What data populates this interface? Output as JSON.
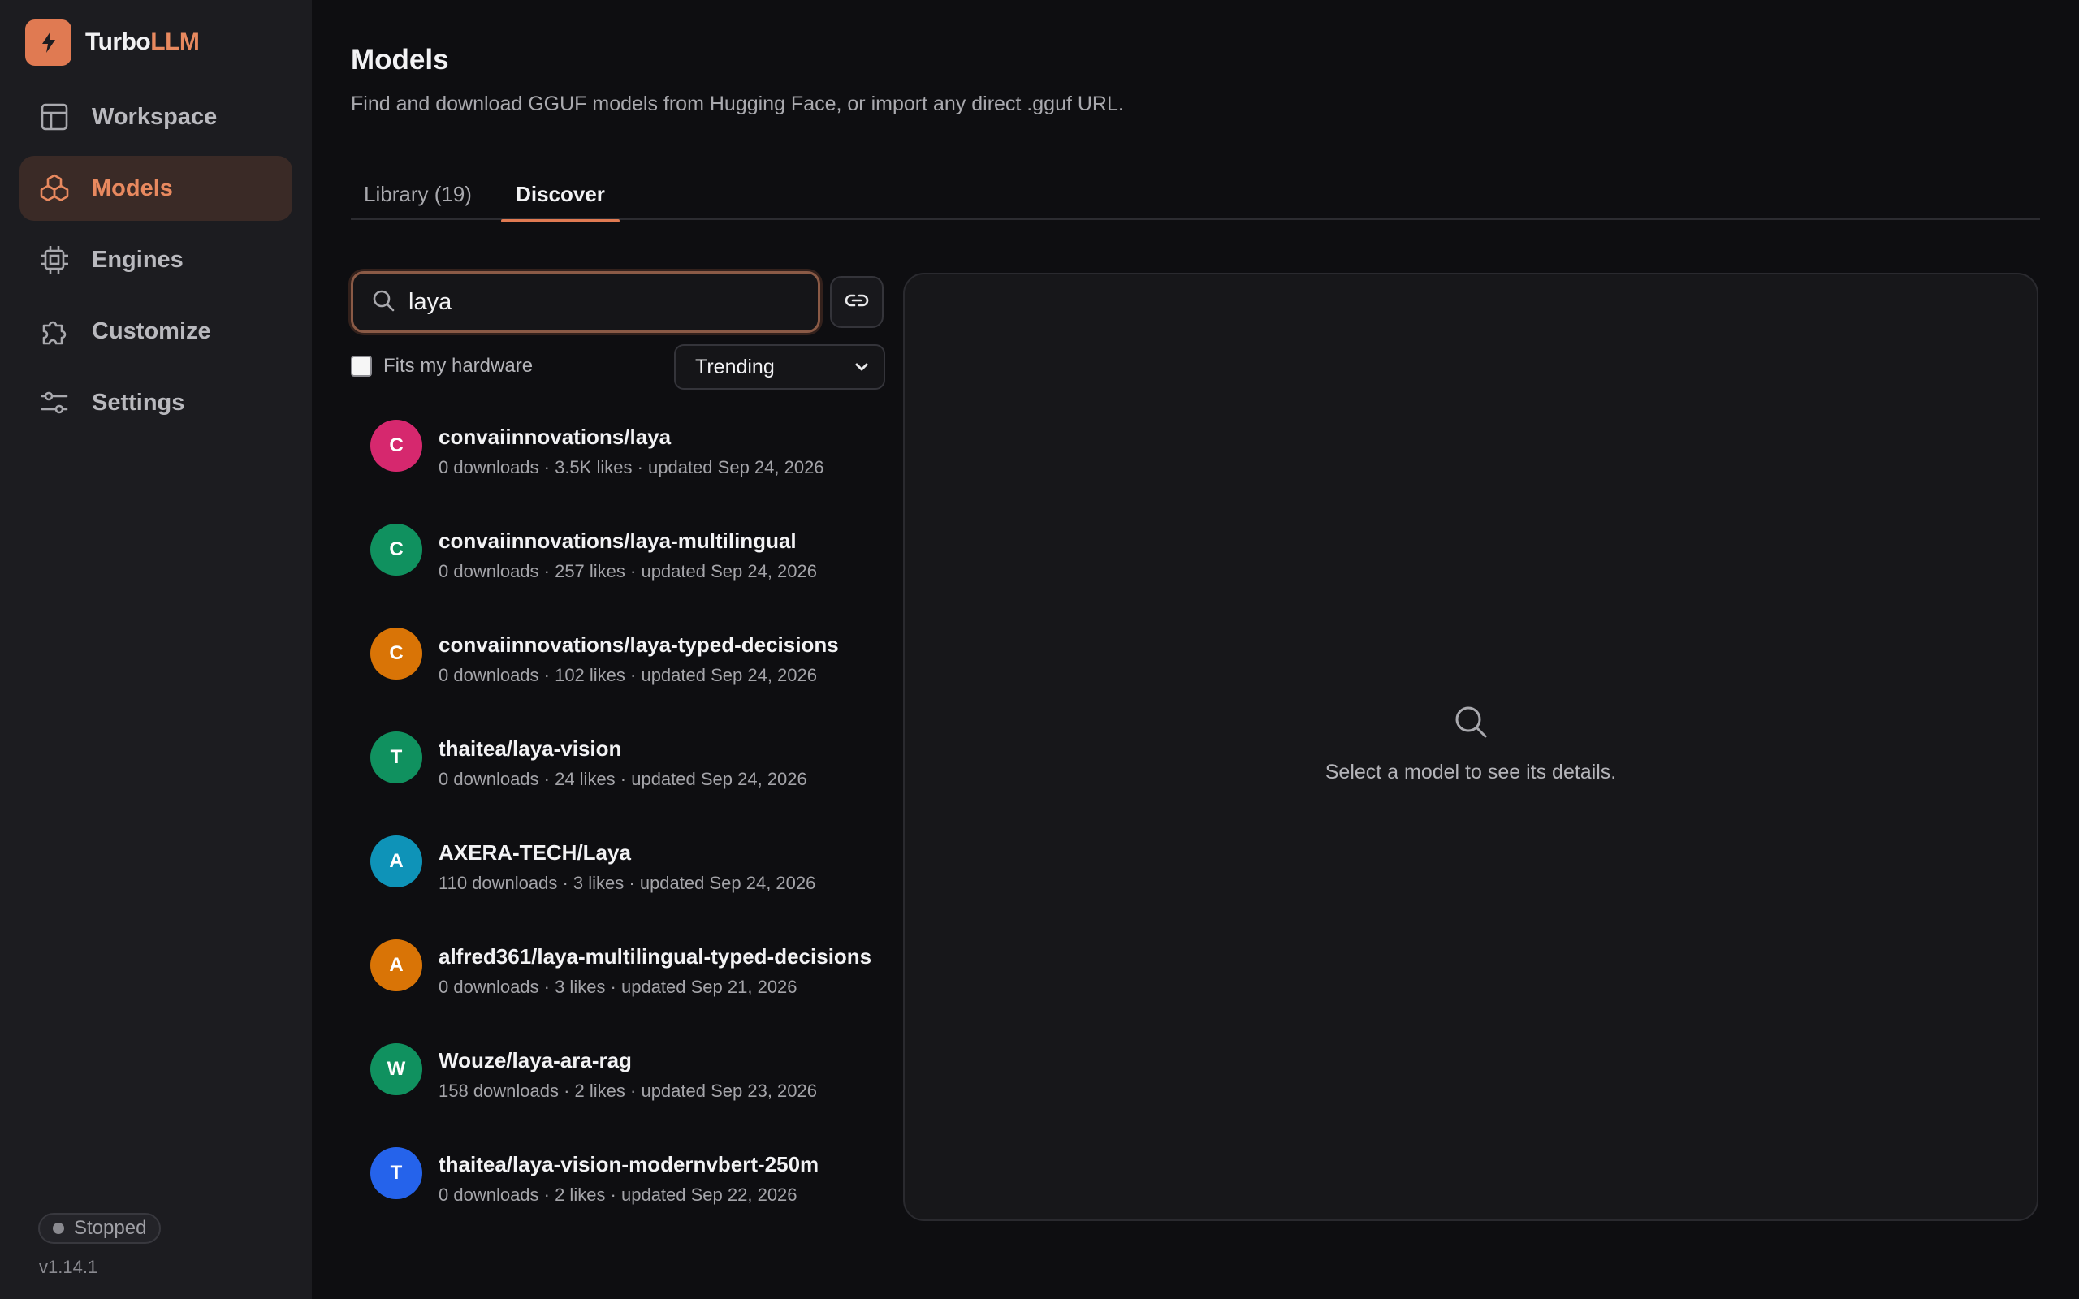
{
  "brand": {
    "name_part1": "Turbo",
    "name_part2": "LLM",
    "accent_color": "#e07a52"
  },
  "sidebar": {
    "items": [
      {
        "label": "Workspace",
        "icon": "workspace-icon",
        "active": false
      },
      {
        "label": "Models",
        "icon": "models-icon",
        "active": true
      },
      {
        "label": "Engines",
        "icon": "chip-icon",
        "active": false
      },
      {
        "label": "Customize",
        "icon": "puzzle-icon",
        "active": false
      },
      {
        "label": "Settings",
        "icon": "sliders-icon",
        "active": false
      }
    ],
    "status": "Stopped",
    "version": "v1.14.1"
  },
  "page": {
    "title": "Models",
    "subtitle": "Find and download GGUF models from Hugging Face, or import any direct .gguf URL."
  },
  "tabs": {
    "library": "Library (19)",
    "discover": "Discover",
    "active": "discover"
  },
  "search": {
    "value": "laya",
    "placeholder": ""
  },
  "filters": {
    "hardware_label": "Fits my hardware",
    "hardware_checked": false,
    "sort_value": "Trending"
  },
  "results": [
    {
      "initial": "C",
      "color": "#d6286e",
      "name": "convaiinnovations/laya",
      "meta": "0 downloads · 3.5K likes · updated Sep 24, 2026"
    },
    {
      "initial": "C",
      "color": "#10915f",
      "name": "convaiinnovations/laya-multilingual",
      "meta": "0 downloads · 257 likes · updated Sep 24, 2026"
    },
    {
      "initial": "C",
      "color": "#d97406",
      "name": "convaiinnovations/laya-typed-decisions",
      "meta": "0 downloads · 102 likes · updated Sep 24, 2026"
    },
    {
      "initial": "T",
      "color": "#10915f",
      "name": "thaitea/laya-vision",
      "meta": "0 downloads · 24 likes · updated Sep 24, 2026"
    },
    {
      "initial": "A",
      "color": "#0e93b8",
      "name": "AXERA-TECH/Laya",
      "meta": "110 downloads · 3 likes · updated Sep 24, 2026"
    },
    {
      "initial": "A",
      "color": "#d97406",
      "name": "alfred361/laya-multilingual-typed-decisions",
      "meta": "0 downloads · 3 likes · updated Sep 21, 2026"
    },
    {
      "initial": "W",
      "color": "#10915f",
      "name": "Wouze/laya-ara-rag",
      "meta": "158 downloads · 2 likes · updated Sep 23, 2026"
    },
    {
      "initial": "T",
      "color": "#2563eb",
      "name": "thaitea/laya-vision-modernvbert-250m",
      "meta": "0 downloads · 2 likes · updated Sep 22, 2026"
    }
  ],
  "detail": {
    "empty_message": "Select a model to see its details."
  }
}
